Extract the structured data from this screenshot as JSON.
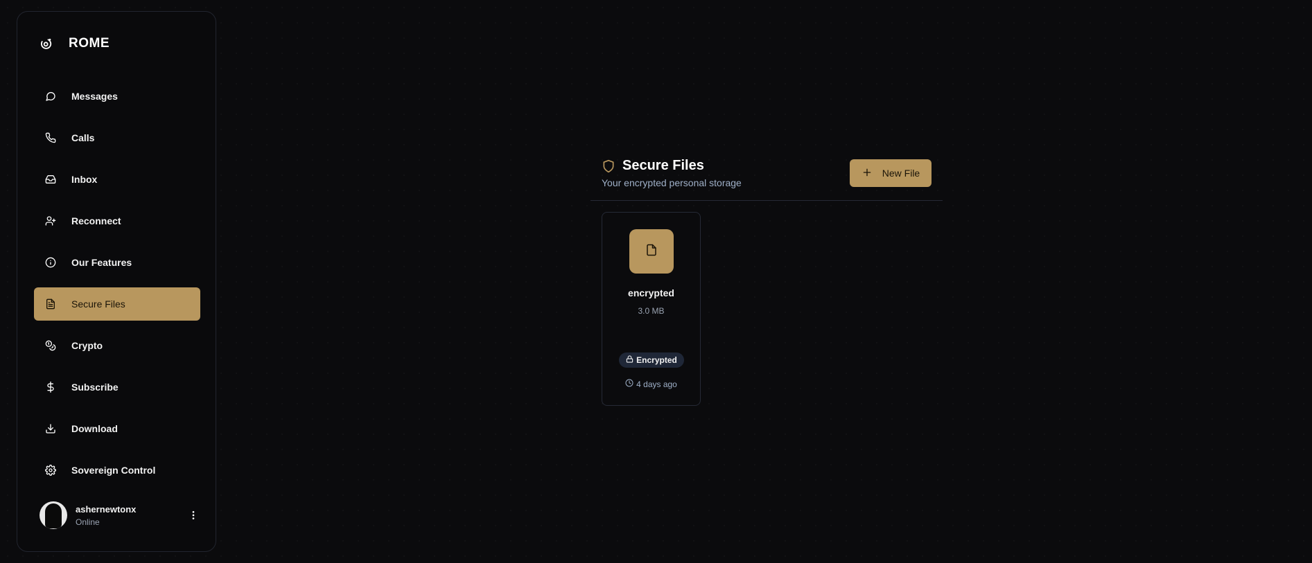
{
  "brand": {
    "name": "ROME",
    "icon": "orbit-icon"
  },
  "sidebar": {
    "items": [
      {
        "label": "Messages",
        "icon": "message-circle-icon"
      },
      {
        "label": "Calls",
        "icon": "phone-icon"
      },
      {
        "label": "Inbox",
        "icon": "inbox-icon"
      },
      {
        "label": "Reconnect",
        "icon": "user-plus-icon"
      },
      {
        "label": "Our Features",
        "icon": "info-icon"
      },
      {
        "label": "Secure Files",
        "icon": "file-text-icon",
        "active": true
      },
      {
        "label": "Crypto",
        "icon": "coins-icon"
      },
      {
        "label": "Subscribe",
        "icon": "dollar-icon"
      },
      {
        "label": "Download",
        "icon": "download-icon"
      },
      {
        "label": "Sovereign Control",
        "icon": "gear-icon"
      }
    ]
  },
  "user": {
    "name": "ashernewtonx",
    "status": "Online"
  },
  "main": {
    "title": "Secure Files",
    "subtitle": "Your encrypted personal storage",
    "new_button_label": "New File",
    "files": [
      {
        "name": "encrypted",
        "size": "3.0 MB",
        "badge": "Encrypted",
        "time": "4 days ago"
      }
    ]
  },
  "colors": {
    "accent": "#b8975e",
    "background": "#0b0b0d",
    "border": "#262a36",
    "muted_text": "#9fb0c8",
    "badge_bg": "#1f2737"
  }
}
